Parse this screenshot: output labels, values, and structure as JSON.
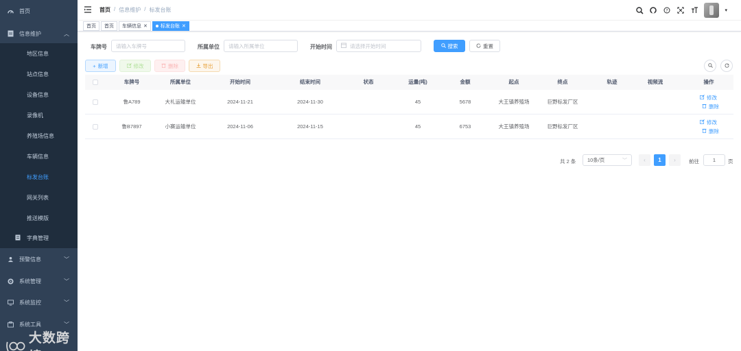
{
  "colors": {
    "sidebar_bg": "#304156",
    "submenu_bg": "#1f2d3d",
    "primary": "#409eff",
    "active_menu": "#409eff"
  },
  "sidebar": {
    "items": [
      {
        "label": "首页",
        "icon": "dashboard-icon"
      },
      {
        "label": "信息维护",
        "icon": "document-icon",
        "expanded": true
      },
      {
        "label": "地区信息"
      },
      {
        "label": "站点信息"
      },
      {
        "label": "设备信息"
      },
      {
        "label": "录像机"
      },
      {
        "label": "养殖场信息"
      },
      {
        "label": "车辆信息"
      },
      {
        "label": "标发台账",
        "active": true
      },
      {
        "label": "网关列表"
      },
      {
        "label": "推送模版"
      },
      {
        "label": "字典管理",
        "icon": "dictionary-icon"
      },
      {
        "label": "预警信息",
        "icon": "warning-icon"
      },
      {
        "label": "系统管理",
        "icon": "system-icon"
      },
      {
        "label": "系统监控",
        "icon": "monitor-icon"
      },
      {
        "label": "系统工具",
        "icon": "tool-icon"
      }
    ]
  },
  "watermark": "大数跨境",
  "header": {
    "breadcrumb": [
      "首页",
      "/",
      "信息维护",
      "/",
      "标发台账"
    ],
    "icons": [
      "search-icon",
      "github-icon",
      "help-icon",
      "fullscreen-icon",
      "font-size-icon"
    ]
  },
  "tags": [
    {
      "label": "首页"
    },
    {
      "label": "首页"
    },
    {
      "label": "车辆信息",
      "closable": true
    },
    {
      "label": "标发台账",
      "closable": true,
      "active": true
    }
  ],
  "search": {
    "plate_label": "车牌号",
    "plate_placeholder": "请输入车牌号",
    "unit_label": "所属单位",
    "unit_placeholder": "请输入所属单位",
    "start_label": "开始时间",
    "start_placeholder": "请选择开始时间",
    "search_btn": "搜索",
    "reset_btn": "重置"
  },
  "toolbar": {
    "add": "新增",
    "edit": "修改",
    "delete": "删除",
    "export": "导出"
  },
  "table": {
    "columns": [
      "车牌号",
      "所属单位",
      "开始时间",
      "结束时间",
      "状态",
      "运量(吨)",
      "金额",
      "起点",
      "终点",
      "轨迹",
      "视频流",
      "操作"
    ],
    "rows": [
      {
        "plate": "鲁A789",
        "unit": "大礼运输单位",
        "start": "2024-11-21",
        "end": "2024-11-30",
        "status": "",
        "volume": "45",
        "amount": "5678",
        "origin": "大王镇养殖场",
        "dest": "巨野标发厂区",
        "track": "",
        "video": ""
      },
      {
        "plate": "鲁B7897",
        "unit": "小赛运输单位",
        "start": "2024-11-06",
        "end": "2024-11-15",
        "status": "",
        "volume": "45",
        "amount": "6753",
        "origin": "大王镇养殖场",
        "dest": "巨野标发厂区",
        "track": "",
        "video": ""
      }
    ],
    "op_edit": "修改",
    "op_delete": "删除"
  },
  "pagination": {
    "total_text": "共 2 条",
    "page_size": "10条/页",
    "current_page": "1",
    "goto_label": "前往",
    "goto_value": "1",
    "page_suffix": "页"
  }
}
